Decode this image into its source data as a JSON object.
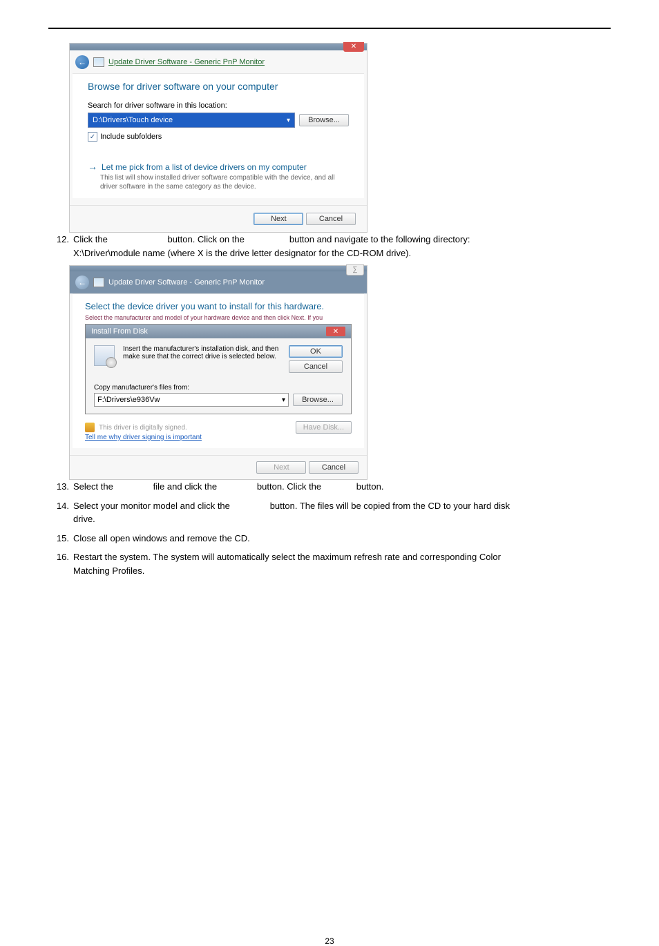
{
  "dialog1": {
    "nav_text": "Update Driver Software - Generic PnP Monitor",
    "heading": "Browse for driver software on your computer",
    "search_label": "Search for driver software in this location:",
    "path_value": "D:\\Drivers\\Touch device",
    "browse": "Browse...",
    "include_sub": "Include subfolders",
    "option_title": "Let me pick from a list of device drivers on my computer",
    "option_sub1": "This list will show installed driver software compatible with the device, and all",
    "option_sub2": "driver software in the same category as the device.",
    "next": "Next",
    "cancel": "Cancel"
  },
  "step12": {
    "num": "12.",
    "t1": "Click the ",
    "t2": " button. Click on the ",
    "t3": " button and navigate to the following directory:",
    "sub": "X:\\Driver\\module name (where X is the drive letter designator for the CD-ROM drive)."
  },
  "dialog2": {
    "nav_text": "Update Driver Software - Generic PnP Monitor",
    "heading": "Select the device driver you want to install for this hardware.",
    "cut": "Select the manufacturer and model of your hardware device and then click Next. If you",
    "install_title": "Install From Disk",
    "install_text": "Insert the manufacturer's installation disk, and then make sure that the correct drive is selected below.",
    "ok": "OK",
    "cancel2": "Cancel",
    "copy_label": "Copy manufacturer's files from:",
    "copy_value": "F:\\Drivers\\e936Vw",
    "browse2": "Browse...",
    "sig_text": "This driver is digitally signed.",
    "sig_link": "Tell me why driver signing is important",
    "have_disk": "Have Disk...",
    "next2": "Next",
    "cancel3": "Cancel"
  },
  "step13": {
    "num": "13.",
    "t1": "Select the ",
    "t2": " file and click the ",
    "t3": " button. Click the ",
    "t4": " button."
  },
  "step14": {
    "num": "14.",
    "t1": "Select your monitor model and click the ",
    "t2": " button. The files will be copied from the CD to your hard disk",
    "t3": "drive."
  },
  "step15": {
    "num": "15.",
    "t": "Close all open windows and remove the CD."
  },
  "step16": {
    "num": "16.",
    "t1": "Restart the system. The system will automatically select the maximum refresh rate and corresponding Color",
    "t2": "Matching Profiles."
  },
  "page": "23"
}
